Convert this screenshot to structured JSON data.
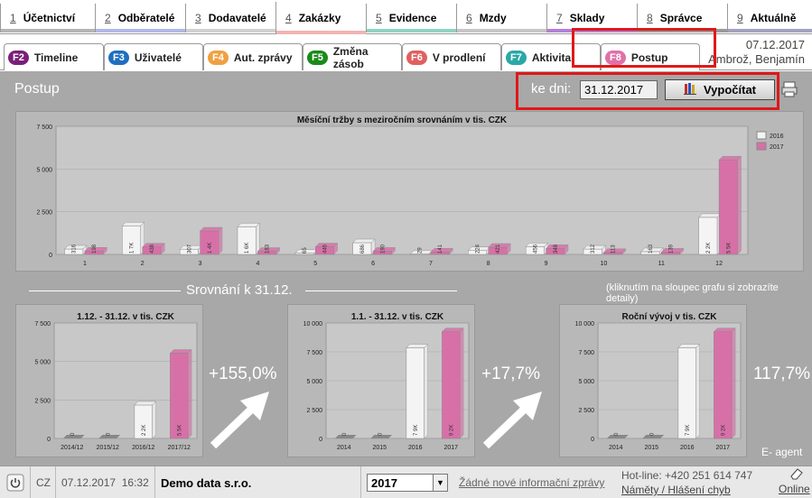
{
  "top_tabs": [
    {
      "num": "1",
      "label": "Účetnictví",
      "color": "#b5b5b5"
    },
    {
      "num": "2",
      "label": "Odběratelé",
      "color": "#b1b8e8"
    },
    {
      "num": "3",
      "label": "Dodavatelé",
      "color": "#d1d1d1"
    },
    {
      "num": "4",
      "label": "Zakázky",
      "color": "#f2b3b3"
    },
    {
      "num": "5",
      "label": "Evidence",
      "color": "#8fd3c3"
    },
    {
      "num": "6",
      "label": "Mzdy",
      "color": "#c7c7c7"
    },
    {
      "num": "7",
      "label": "Sklady",
      "color": "#b57ed8"
    },
    {
      "num": "8",
      "label": "Správce",
      "color": "#9a9a9a"
    },
    {
      "num": "9",
      "label": "Aktuálně",
      "color": "#a2a2c2"
    }
  ],
  "sub_tabs": [
    {
      "key": "F2",
      "label": "Timeline",
      "color": "#7a1f7a"
    },
    {
      "key": "F3",
      "label": "Uživatelé",
      "color": "#1f6fbf"
    },
    {
      "key": "F4",
      "label": "Aut. zprávy",
      "color": "#f0a040"
    },
    {
      "key": "F5",
      "label": "Změna zásob",
      "color": "#1a8a1a"
    },
    {
      "key": "F6",
      "label": "V prodlení",
      "color": "#e06060"
    },
    {
      "key": "F7",
      "label": "Aktivita",
      "color": "#2aa8a8"
    },
    {
      "key": "F8",
      "label": "Postup",
      "color": "#e070a8"
    }
  ],
  "header_info": {
    "date": "07.12.2017",
    "user": "Ambrož, Benjamín"
  },
  "page_title": "Postup",
  "ke_dni_label": "ke dni:",
  "date_value": "31.12.2017",
  "calculate_label": "Vypočítat",
  "section_title": "Srovnání k 31.12.",
  "hint": "(kliknutím na sloupec grafu si zobrazíte detaily)",
  "pct_1": "+155,0%",
  "pct_2": "+17,7%",
  "pct_3": "117,7%",
  "e_agent": "E- agent",
  "colors": {
    "series_2016": "#f4f4f4",
    "series_2017": "#d870a8",
    "chart_bg": "#c8c8c8"
  },
  "chart_data": [
    {
      "type": "bar",
      "title": "Měsíční tržby s meziročním srovnáním v tis. CZK",
      "categories": [
        "1",
        "2",
        "3",
        "4",
        "5",
        "6",
        "7",
        "8",
        "9",
        "10",
        "11",
        "12"
      ],
      "series": [
        {
          "name": "2016",
          "values": [
            316,
            1674,
            307,
            1618,
            65,
            686,
            29,
            224,
            456,
            312,
            163,
            2171
          ]
        },
        {
          "name": "2017",
          "values": [
            198,
            438,
            1372,
            183,
            446,
            190,
            141,
            421,
            348,
            113,
            139,
            5535
          ]
        }
      ],
      "yticks": [
        "0",
        "2 500",
        "5 000",
        "7 500"
      ],
      "ylim": [
        0,
        7500
      ],
      "legend": "top-right"
    },
    {
      "type": "bar",
      "title": "1.12. - 31.12. v tis. CZK",
      "categories": [
        "2014/12",
        "2015/12",
        "2016/12",
        "2017/12"
      ],
      "values": [
        0,
        0,
        2171,
        5535
      ],
      "yticks": [
        "0",
        "2 500",
        "5 000",
        "7 500"
      ],
      "ylim": [
        0,
        7500
      ]
    },
    {
      "type": "bar",
      "title": "1.1. - 31.12. v tis. CZK",
      "categories": [
        "2014",
        "2015",
        "2016",
        "2017"
      ],
      "values": [
        0,
        0,
        7851,
        9242
      ],
      "yticks": [
        "0",
        "2 500",
        "5 000",
        "7 500",
        "10 000"
      ],
      "ylim": [
        0,
        10000
      ]
    },
    {
      "type": "bar",
      "title": "Roční vývoj v tis. CZK",
      "categories": [
        "2014",
        "2015",
        "2016",
        "2017"
      ],
      "values": [
        0,
        0,
        7851,
        9242
      ],
      "yticks": [
        "0",
        "2 500",
        "5 000",
        "7 500",
        "10 000"
      ],
      "ylim": [
        0,
        10000
      ]
    }
  ],
  "status": {
    "cz": "CZ",
    "datetime": "07.12.2017  16:32",
    "company": "Demo data s.r.o.",
    "year": "2017",
    "news_link": "Žádné nové informační zprávy",
    "hotline": "Hot-line: +420 251 614 747",
    "feedback_link": "Náměty / Hlášení chyb",
    "online": "Online"
  }
}
